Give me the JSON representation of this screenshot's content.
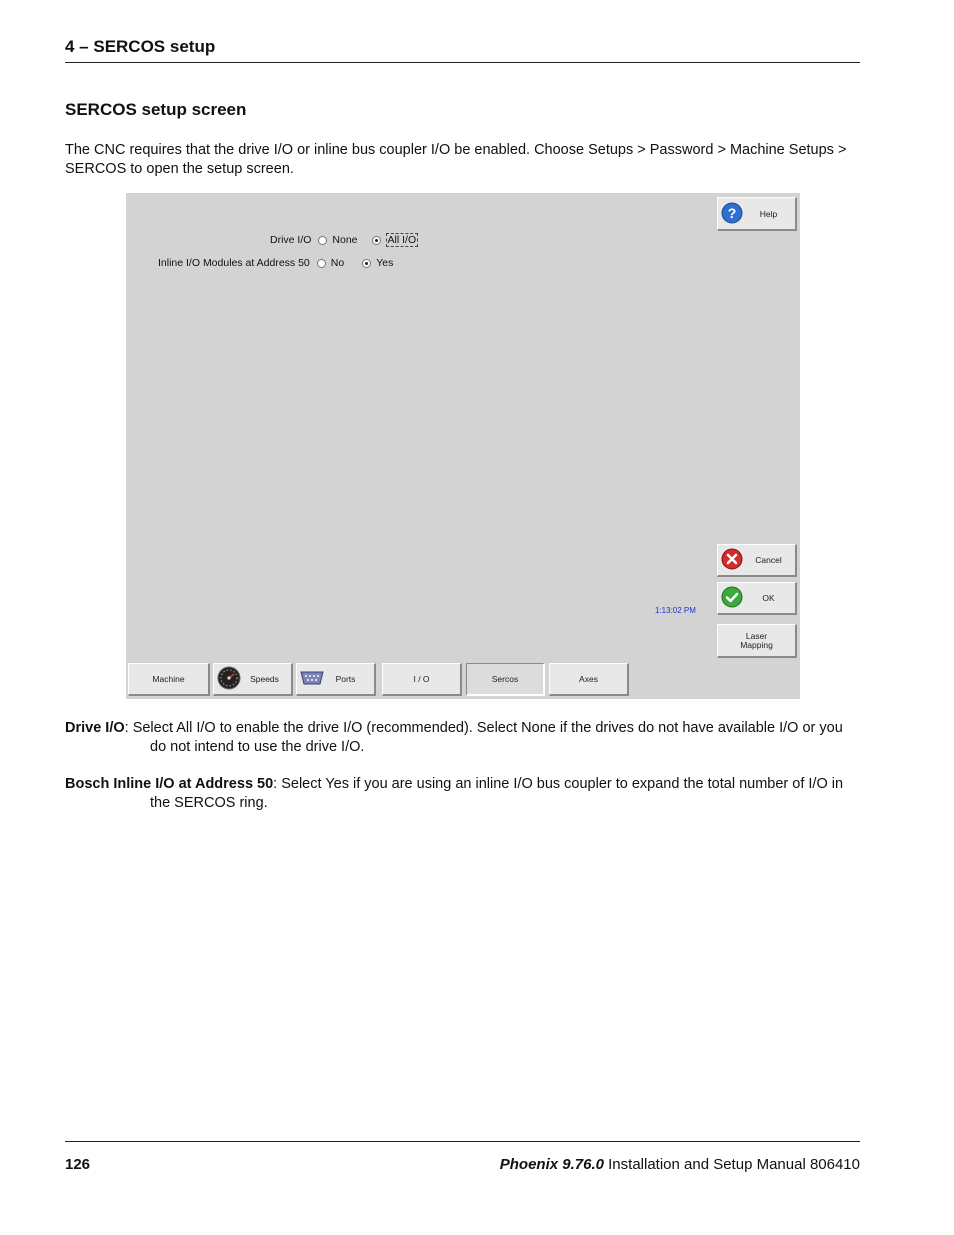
{
  "header": {
    "chapter": "4  –  SERCOS setup"
  },
  "section": {
    "title": "SERCOS setup screen"
  },
  "intro": "The CNC requires that the drive I/O or inline bus coupler I/O be enabled. Choose Setups > Password > Machine Setups > SERCOS to open the setup screen.",
  "screen": {
    "drive_io": {
      "label": "Drive I/O",
      "options": [
        "None",
        "All I/O"
      ],
      "selected": "All I/O"
    },
    "inline_io": {
      "label": "Inline I/O Modules at Address 50",
      "options": [
        "No",
        "Yes"
      ],
      "selected": "Yes"
    },
    "side_buttons": {
      "help": "Help",
      "cancel": "Cancel",
      "ok": "OK",
      "laser_line1": "Laser",
      "laser_line2": "Mapping"
    },
    "clock": "1:13:02 PM",
    "bottom_tabs": [
      "Machine",
      "Speeds",
      "Ports",
      "I / O",
      "Sercos",
      "Axes"
    ],
    "icons": {
      "help": "question-icon",
      "cancel": "red-x-icon",
      "ok": "green-check-icon",
      "speeds": "speedometer-icon",
      "ports": "serial-port-icon"
    },
    "colors": {
      "background": "#d3d3d3",
      "button": "#e8e8e8",
      "clock": "#2233cc",
      "ok": "#3aa83a",
      "cancel": "#d22b2b",
      "help": "#2f6fd0"
    }
  },
  "definitions": [
    {
      "term": "Drive I/O",
      "text": ": Select All I/O to enable the drive I/O (recommended). Select None if the drives do not have available I/O or you do not intend to use the drive I/O."
    },
    {
      "term": "Bosch Inline I/O at Address 50",
      "text": ": Select Yes if you are using an inline I/O bus coupler to expand the total number of I/O in the SERCOS ring."
    }
  ],
  "footer": {
    "page_number": "126",
    "product": "Phoenix 9.76.0",
    "manual": " Installation and Setup Manual  806410"
  }
}
